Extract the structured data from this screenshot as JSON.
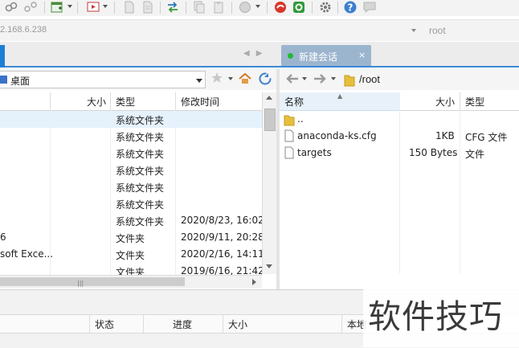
{
  "toolbar": {
    "icons": [
      "link-icon",
      "unlink-icon",
      "new-window-icon",
      "play-icon",
      "page-icon",
      "page-icon-2",
      "transfer-icon",
      "copy-icon",
      "paste-icon",
      "circle-icon",
      "orange-app-icon",
      "green-app-icon",
      "settings-icon",
      "help-icon",
      "chat-icon"
    ]
  },
  "address": {
    "host": "2.168.6.238",
    "session_hint": "root"
  },
  "tabs": {
    "right_session": "新建会话",
    "close": "×"
  },
  "left_panel": {
    "path": "桌面",
    "columns": {
      "size": "大小",
      "type": "类型",
      "modified": "修改时间"
    },
    "rows": [
      {
        "name": "",
        "size": "",
        "type": "系统文件夹",
        "modified": ""
      },
      {
        "name": "",
        "size": "",
        "type": "系统文件夹",
        "modified": ""
      },
      {
        "name": "",
        "size": "",
        "type": "系统文件夹",
        "modified": ""
      },
      {
        "name": "",
        "size": "",
        "type": "系统文件夹",
        "modified": ""
      },
      {
        "name": "",
        "size": "",
        "type": "系统文件夹",
        "modified": ""
      },
      {
        "name": "",
        "size": "",
        "type": "系统文件夹",
        "modified": ""
      },
      {
        "name": "",
        "size": "",
        "type": "系统文件夹",
        "modified": "2020/8/23, 16:02"
      },
      {
        "name": "6",
        "size": "",
        "type": "文件夹",
        "modified": "2020/9/11, 20:28"
      },
      {
        "name": "soft Exce...",
        "size": "",
        "type": "文件夹",
        "modified": "2020/2/16, 14:11"
      },
      {
        "name": "",
        "size": "",
        "type": "文件夹",
        "modified": "2019/6/16, 21:42"
      }
    ]
  },
  "right_panel": {
    "path": "/root",
    "columns": {
      "name": "名称",
      "size": "大小",
      "type": "类型"
    },
    "rows": [
      {
        "name": "..",
        "size": "",
        "type": "",
        "icon": "folder-icon"
      },
      {
        "name": "anaconda-ks.cfg",
        "size": "1KB",
        "type": "CFG 文件",
        "icon": "file-icon"
      },
      {
        "name": "targets",
        "size": "150 Bytes",
        "type": "文件",
        "icon": "file-icon"
      }
    ]
  },
  "transfers": {
    "columns": {
      "status": "状态",
      "progress": "进度",
      "size": "大小",
      "local": "本地"
    }
  },
  "watermark": "软件技巧",
  "colors": {
    "accent": "#3d87d2",
    "tab_active": "#9cb5cf",
    "selected_row": "#e5f1fb",
    "online_dot": "#22bb33"
  }
}
